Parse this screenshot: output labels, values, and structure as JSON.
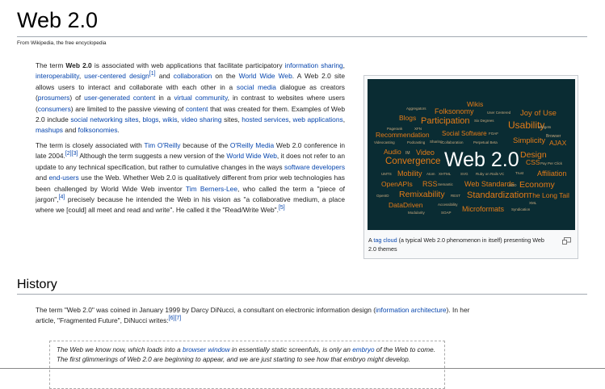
{
  "page": {
    "title": "Web 2.0",
    "tagline": "From Wikipedia, the free encyclopedia"
  },
  "intro": {
    "p1": {
      "t1": "The term ",
      "term": "Web 2.0",
      "t2": " is associated with web applications that facilitate participatory ",
      "l_info_sharing": "information sharing",
      "t3": ", ",
      "l_interop": "interoperability",
      "t4": ", ",
      "l_ucd": "user-centered design",
      "ref1": "[1]",
      "t5": " and ",
      "l_collab": "collaboration",
      "t6": " on the ",
      "l_www": "World Wide Web",
      "t7": ". A Web 2.0 site allows users to interact and collaborate with each other in a ",
      "l_social_media": "social media",
      "t8": " dialogue as creators (",
      "l_prosumers": "prosumers",
      "t9": ") of ",
      "l_ugc": "user-generated content",
      "t10": " in a ",
      "l_virtual": "virtual community",
      "t11": ", in contrast to websites where users (",
      "l_consumers": "consumers",
      "t12": ") are limited to the passive viewing of ",
      "l_content": "content",
      "t13": " that was created for them. Examples of Web 2.0 include ",
      "l_sns": "social networking sites",
      "t14": ", ",
      "l_blogs": "blogs",
      "t15": ", ",
      "l_wikis": "wikis",
      "t16": ", ",
      "l_video": "video sharing",
      "t17": " sites, ",
      "l_hosted": "hosted services",
      "t18": ", ",
      "l_webapps": "web applications",
      "t19": ", ",
      "l_mashups": "mashups",
      "t20": " and ",
      "l_folk": "folksonomies",
      "t21": "."
    },
    "p2": {
      "t1": "The term is closely associated with ",
      "l_oreilly": "Tim O'Reilly",
      "t2": " because of the ",
      "l_orm": "O'Reilly Media",
      "t3": " Web 2.0 conference in late 2004.",
      "ref2": "[2]",
      "ref3": "[3]",
      "t4": " Although the term suggests a new version of the ",
      "l_www": "World Wide Web",
      "t5": ", it does not refer to an update to any technical specification, but rather to cumulative changes in the ways ",
      "l_devs": "software developers",
      "t6": " and ",
      "l_endusers": "end-users",
      "t7": " use the Web. Whether Web 2.0 is qualitatively different from prior web technologies has been challenged by World Wide Web inventor ",
      "l_tbl": "Tim Berners-Lee",
      "t8": ", who called the term a \"piece of jargon\",",
      "ref4": "[4]",
      "t9": " precisely because he intended the Web in his vision as \"a collaborative medium, a place where we [could] all meet and read and write\". He called it the \"Read/Write Web\".",
      "ref5": "[5]"
    }
  },
  "thumbnail": {
    "caption_pre": "A ",
    "caption_link": "tag cloud",
    "caption_post": " (a typical Web 2.0 phenomenon in itself) presenting Web 2.0 themes",
    "center_text": "Web 2.0",
    "tags": [
      "Aggregators",
      "Wikis",
      "Folksonomy",
      "User Centered",
      "Joy of Use",
      "Blogs",
      "Participation",
      "Six Degrees",
      "Usability",
      "Widgets",
      "Pagerank",
      "XFN",
      "Recommendation",
      "Social Software",
      "FOAF",
      "Browser",
      "Videocasting",
      "Podcasting",
      "Sharing",
      "Collaboration",
      "Perpetual Beta",
      "Simplicity",
      "AJAX",
      "Audio",
      "IM",
      "Video",
      "Design",
      "Convergence",
      "CSS",
      "Pay Per Click",
      "UMTS",
      "Mobility",
      "Atom",
      "XHTML",
      "SVG",
      "Ruby on Rails",
      "VC",
      "Trust",
      "Affiliation",
      "OpenAPIs",
      "RSS",
      "Semantic",
      "Web Standards",
      "SEO",
      "Economy",
      "OpenID",
      "Remixability",
      "REST",
      "Standardization",
      "The Long Tail",
      "DataDriven",
      "Accessibility",
      "XML",
      "Microformats",
      "Syndication",
      "Modularity",
      "SOAP"
    ]
  },
  "history": {
    "heading": "History",
    "p3": {
      "t1": "The term \"Web 2.0\" was coined in January 1999 by Darcy DiNucci, a consultant on electronic information design (",
      "l_ia": "information architecture",
      "t2": "). In her article, \"Fragmented Future\", DiNucci writes:",
      "ref6": "[6]",
      "ref7": "[7]"
    },
    "quote": {
      "t1": "The Web we know now, which loads into a ",
      "l_browser": "browser window",
      "t2": " in essentially static screenfuls, is only an ",
      "l_embryo": "embryo",
      "t3": " of the Web to come. The first glimmerings of Web 2.0 are beginning to appear, and we are just starting to see how that embryo might develop."
    }
  },
  "colors": {
    "link": "#0645ad",
    "tagcloud_bg": "#0a2c33",
    "tag_orange": "#e47b17",
    "tag_light": "#c8a97e",
    "tag_white": "#ffffff"
  }
}
